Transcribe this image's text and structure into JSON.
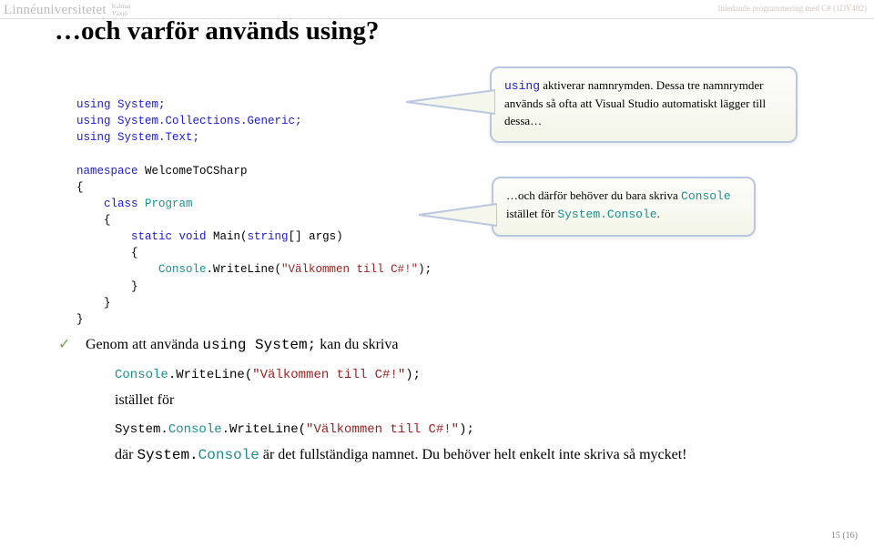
{
  "header": {
    "logo": "Linnéuniversitetet",
    "logo_sub1": "Kalmar",
    "logo_sub2": "Växjö",
    "course": "Inledande programmering med C# (1DV402)"
  },
  "title": "…och varför används using?",
  "code": {
    "l1": "using System;",
    "l2": "using System.Collections.Generic;",
    "l3": "using System.Text;",
    "l4": "",
    "l5_a": "namespace",
    "l5_b": " WelcomeToCSharp",
    "l6": "{",
    "l7_a": "    class",
    "l7_b": " Program",
    "l8": "    {",
    "l9_a": "        static void",
    "l9_b": " Main(",
    "l9_c": "string",
    "l9_d": "[] args)",
    "l10": "        {",
    "l11_a": "            Console",
    "l11_b": ".WriteLine(",
    "l11_c": "\"Välkommen till C#!\"",
    "l11_d": ");",
    "l12": "        }",
    "l13": "    }",
    "l14": "}"
  },
  "callout1": {
    "part1a": "using",
    "part1b": " aktiverar namnrymden. Dessa tre namnrymder används så ofta att Visual Studio automatiskt lägger till dessa…"
  },
  "callout2": {
    "part1": "…och därför behöver du bara skriva ",
    "code1": "Console",
    "part2": " istället för ",
    "code2": "System.Console",
    "part3": "."
  },
  "bullet": {
    "lead_a": "Genom att använda ",
    "lead_code": "using System;",
    "lead_b": " kan du skriva",
    "line1": "Console.WriteLine(\"Välkommen till C#!\");",
    "mid": "istället för",
    "line2": "System.Console.WriteLine(\"Välkommen till C#!\");",
    "tail_a": "där ",
    "tail_code": "System.Console",
    "tail_b": " är det fullständiga namnet. Du behöver helt enkelt inte skriva så mycket!"
  },
  "pagenum": {
    "current": "15",
    "total": "16"
  }
}
